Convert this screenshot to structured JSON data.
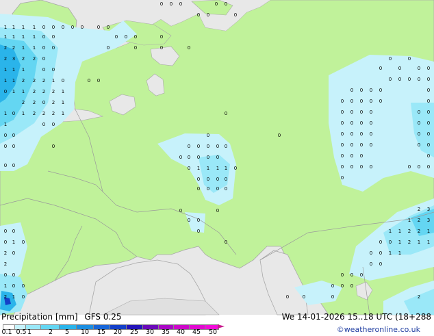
{
  "title": "Precipitation [mm]",
  "model": "GFS 0.25",
  "valid_time": "We 14-01-2026 15..18 UTC (18+288",
  "credit": "©weatheronline.co.uk",
  "legend": {
    "ticks": [
      "0.1",
      "0.5",
      "1",
      "2",
      "5",
      "10",
      "15",
      "20",
      "25",
      "30",
      "35",
      "40",
      "45",
      "50"
    ],
    "colors": [
      "#ffffff",
      "#c7f2fb",
      "#9ae8f8",
      "#64d6f2",
      "#2ab4ea",
      "#1c8ee0",
      "#1866d8",
      "#1440c8",
      "#2414b8",
      "#6a0ab8",
      "#a808c4",
      "#cc08c8",
      "#e00ad0",
      "#f00cd8",
      "#c8188c"
    ]
  },
  "colors": {
    "land": "#c0f29a",
    "sea": "#e8e8e8",
    "border": "#9a9a9a",
    "coast": "#a8a8a8",
    "rain_light": "#c7f2fb",
    "rain_mid": "#9ae8f8",
    "rain_heavy": "#64d6f2",
    "rain_strong": "#2ab4ea"
  },
  "labels": [
    "0",
    "1",
    "2",
    "3"
  ]
}
